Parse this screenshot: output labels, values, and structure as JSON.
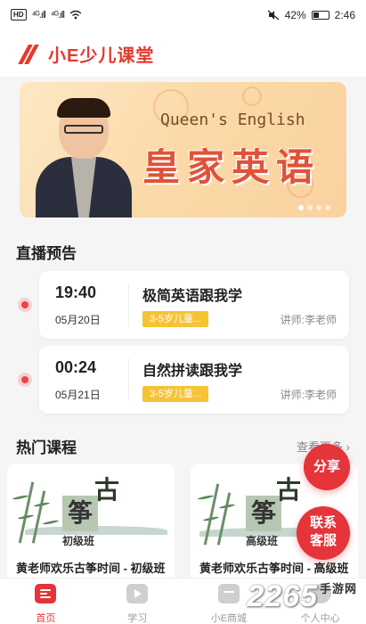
{
  "status_bar": {
    "hd_badge": "HD",
    "signal_1": "⁴ᴳ.ıll",
    "signal_2": "⁴ᴳ.ıll",
    "wifi_icon": "wifi-icon",
    "battery_percent": "42%",
    "battery_level": 0.42,
    "time": "2:46"
  },
  "header": {
    "logo_text": "小E少儿课堂"
  },
  "banner": {
    "english_text": "Queen's English",
    "chinese_text": "皇家英语",
    "slide_count": 4,
    "active_slide": 0
  },
  "live_preview": {
    "title": "直播预告",
    "items": [
      {
        "time": "19:40",
        "date": "05月20日",
        "title": "极简英语跟我学",
        "tag": "3-5岁儿童...",
        "teacher": "讲师:李老师"
      },
      {
        "time": "00:24",
        "date": "05月21日",
        "title": "自然拼读跟我学",
        "tag": "3-5岁儿童...",
        "teacher": "讲师:李老师"
      }
    ]
  },
  "hot_courses": {
    "title": "热门课程",
    "more_label": "查看更多",
    "items": [
      {
        "zheng": "筝",
        "gu": "古",
        "level": "初级班",
        "title": "黄老师欢乐古筝时间 - 初级班"
      },
      {
        "zheng": "筝",
        "gu": "古",
        "level": "高级班",
        "title": "黄老师欢乐古筝时间 - 高级班"
      }
    ]
  },
  "floating": {
    "share_label": "分享",
    "contact_line1": "联系",
    "contact_line2": "客服"
  },
  "tabbar": {
    "tabs": [
      {
        "label": "首页",
        "active": true
      },
      {
        "label": "学习",
        "active": false
      },
      {
        "label": "小E商城",
        "active": false
      },
      {
        "label": "个人中心",
        "active": false
      }
    ]
  },
  "watermark": {
    "main": "2265",
    "sub": "手游网"
  },
  "colors": {
    "brand_red": "#e63a2e",
    "tag_yellow": "#f7c234",
    "live_dot": "#e8454a"
  }
}
